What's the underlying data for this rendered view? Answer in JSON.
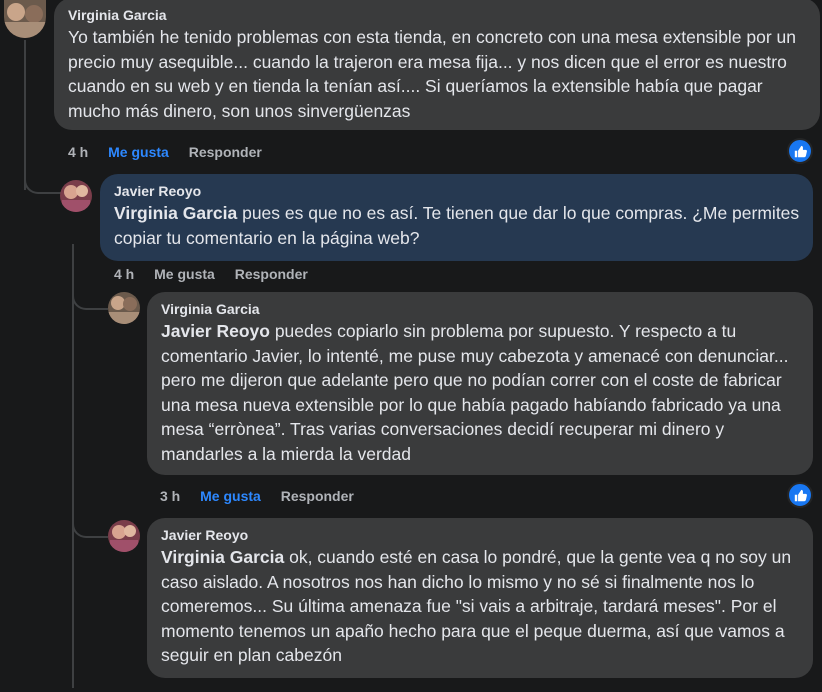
{
  "comments": [
    {
      "author": "Virginia Garcia",
      "text": "Yo también he tenido problemas con esta tienda, en concreto con una mesa extensible por un precio muy asequible... cuando la trajeron era mesa fija... y nos dicen que el error es nuestro cuando en su web y en tienda la tenían así.... Si queríamos la extensible había que pagar mucho más dinero, son unos sinvergüenzas",
      "time": "4 h",
      "like_label": "Me gusta",
      "reply_label": "Responder",
      "reaction_icon": "like-thumb-icon"
    },
    {
      "author": "Javier Reoyo",
      "mention": "Virginia Garcia",
      "text": " pues es que no es así. Te tienen que dar lo que compras. ¿Me permites copiar tu comentario en la página web?",
      "time": "4 h",
      "like_label": "Me gusta",
      "reply_label": "Responder"
    },
    {
      "author": "Virginia Garcia",
      "mention": "Javier Reoyo",
      "text": " puedes copiarlo sin problema por supuesto. Y respecto a tu comentario Javier, lo intenté, me puse muy cabezota y amenacé con denunciar... pero me dijeron que adelante pero que no podían correr con el coste de fabricar una mesa nueva extensible por lo que había pagado habíando fabricado ya una mesa “errònea”. Tras varias conversaciones decidí recuperar mi dinero y mandarles a la mierda la verdad",
      "time": "3 h",
      "like_label": "Me gusta",
      "reply_label": "Responder",
      "reaction_icon": "like-thumb-icon"
    },
    {
      "author": "Javier Reoyo",
      "mention": "Virginia Garcia",
      "text": " ok, cuando esté en casa lo pondré, que la gente vea q no soy un caso aislado. A nosotros nos han dicho lo mismo y no sé si finalmente nos lo comeremos... Su última amenaza fue \"si vais a arbitraje, tardará meses\". Por el momento tenemos un apaño hecho para que el peque duerma, así que vamos a seguir en plan cabezón"
    }
  ],
  "colors": {
    "background": "#18191a",
    "bubble": "#3a3b3c",
    "bubble_highlight": "#263951",
    "liked": "#2d88ff",
    "muted": "#b0b3b8"
  }
}
